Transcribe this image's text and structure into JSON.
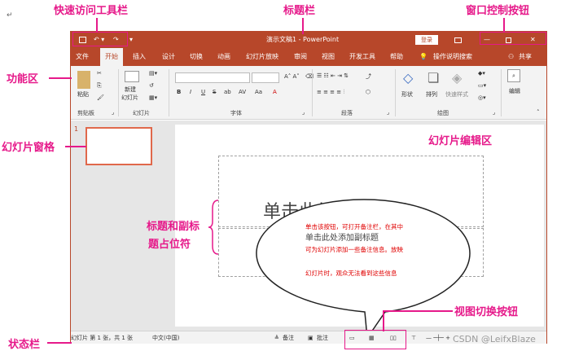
{
  "annotations": {
    "qat": "快速访问工具栏",
    "titlebar": "标题栏",
    "window_controls": "窗口控制按钮",
    "ribbon": "功能区",
    "slide_pane": "幻灯片窗格",
    "edit_area": "幻灯片编辑区",
    "placeholder_line1": "标题和副标",
    "placeholder_line2": "题占位符",
    "view_buttons": "视图切换按钮",
    "statusbar": "状态栏"
  },
  "titlebar": {
    "title": "演示文稿1 - PowerPoint",
    "login": "登录"
  },
  "tabs": [
    "文件",
    "开始",
    "插入",
    "设计",
    "切换",
    "动画",
    "幻灯片放映",
    "审阅",
    "视图",
    "开发工具",
    "帮助",
    "操作说明搜索",
    "共享"
  ],
  "ribbon": {
    "paste": "粘贴",
    "clipboard": "剪贴板",
    "new_slide_1": "新建",
    "new_slide_2": "幻灯片",
    "slides": "幻灯片",
    "font": "字体",
    "paragraph": "段落",
    "shape": "形状",
    "arrange": "排列",
    "quick_style": "快速样式",
    "drawing": "绘图",
    "edit": "编辑",
    "font_btns": [
      "B",
      "I",
      "U",
      "S",
      "ab",
      "AV",
      "Aa",
      "A"
    ]
  },
  "slide_pane": {
    "number": "1"
  },
  "slide": {
    "title_placeholder": "单击此处添加标题",
    "subtitle_placeholder": "单击此处添加副标题",
    "note_line1": "单击该按钮，可打开备注栏，在其中",
    "note_line2": "可为幻灯片添加一些备注信息。放映",
    "note_line3": "幻灯片时，观众无法看到这些信息"
  },
  "statusbar": {
    "slide_count": "幻灯片 第 1 张，共 1 张",
    "language": "中文(中国)",
    "notes": "备注",
    "comments": "批注"
  },
  "watermark": "CSDN @LeifxBlaze",
  "colors": {
    "accent": "#b7472a",
    "annotation": "#e6198a",
    "note_red": "#e00000"
  }
}
